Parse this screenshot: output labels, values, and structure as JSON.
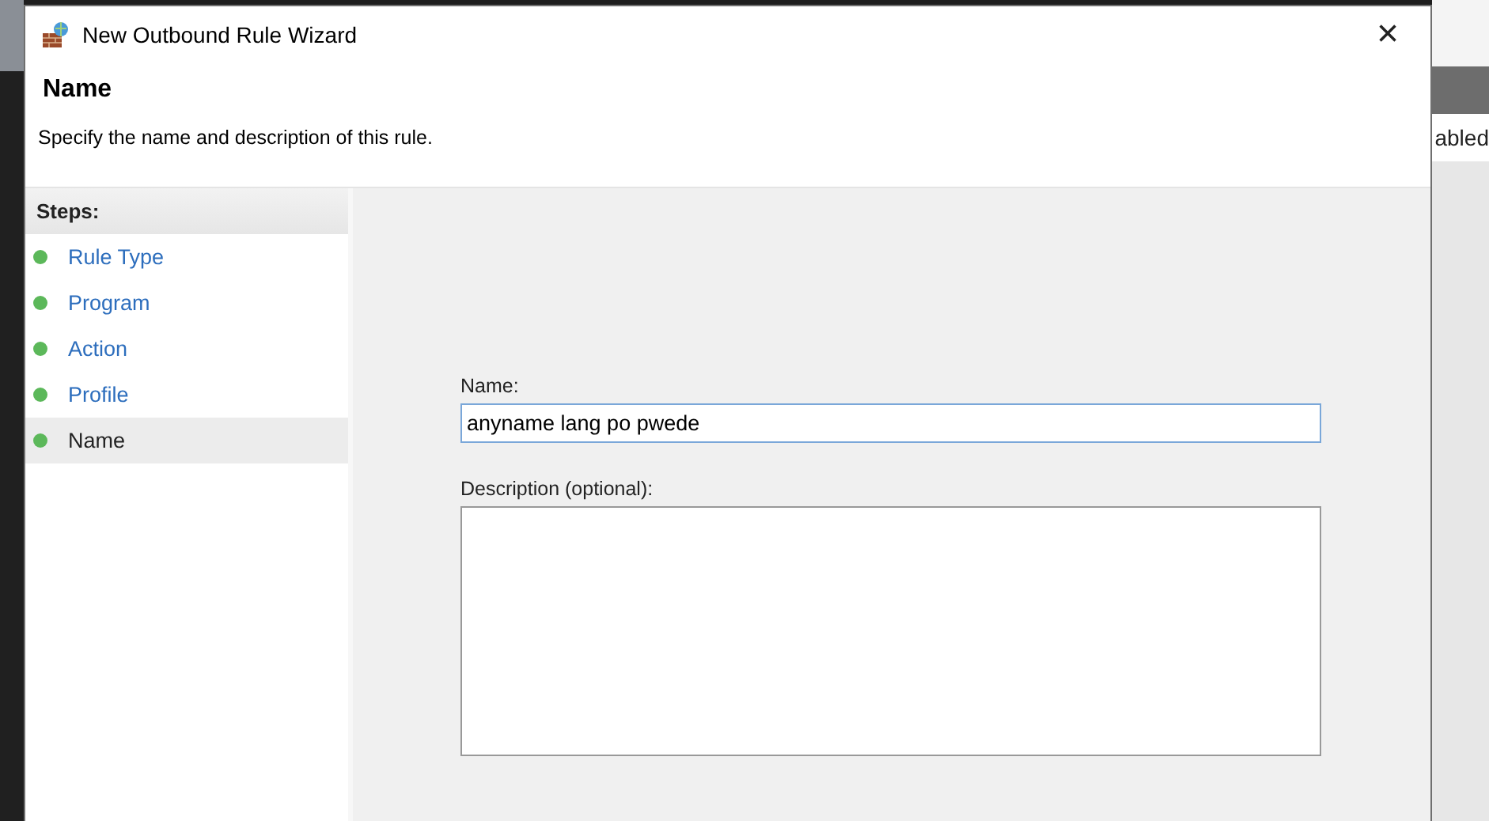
{
  "background_window": {
    "text": "abled"
  },
  "window": {
    "title": "New Outbound Rule Wizard",
    "close": "×"
  },
  "header": {
    "title": "Name",
    "subtitle": "Specify the name and description of this rule."
  },
  "steps": {
    "heading": "Steps:",
    "items": [
      {
        "label": "Rule Type",
        "selected": false
      },
      {
        "label": "Program",
        "selected": false
      },
      {
        "label": "Action",
        "selected": false
      },
      {
        "label": "Profile",
        "selected": false
      },
      {
        "label": "Name",
        "selected": true
      }
    ]
  },
  "form": {
    "name_label": "Name:",
    "name_value": "anyname lang po pwede",
    "description_label": "Description (optional):"
  }
}
